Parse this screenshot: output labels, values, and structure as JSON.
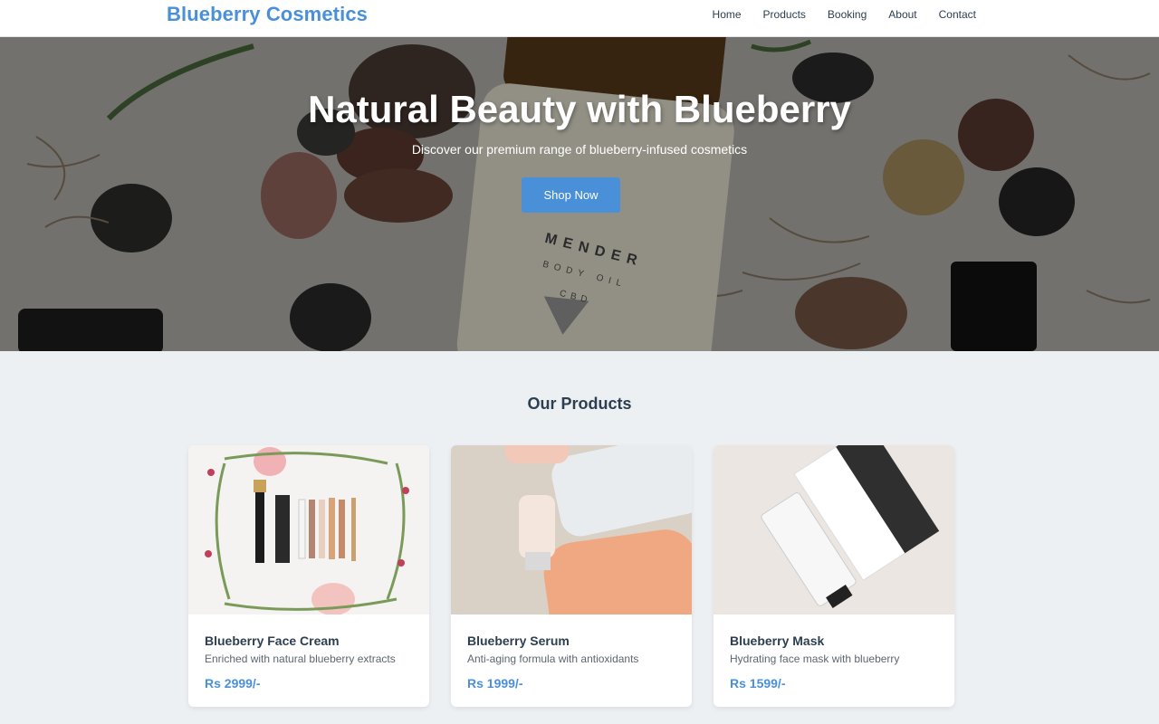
{
  "brand": "Blueberry Cosmetics",
  "nav": {
    "items": [
      {
        "label": "Home"
      },
      {
        "label": "Products"
      },
      {
        "label": "Booking"
      },
      {
        "label": "About"
      },
      {
        "label": "Contact"
      }
    ]
  },
  "hero": {
    "title": "Natural Beauty with Blueberry",
    "subtitle": "Discover our premium range of blueberry-infused cosmetics",
    "cta_label": "Shop Now",
    "bottle_label_lines": [
      "MENDER",
      "BODY OIL",
      "CBD"
    ]
  },
  "products": {
    "heading": "Our Products",
    "items": [
      {
        "name": "Blueberry Face Cream",
        "description": "Enriched with natural blueberry extracts",
        "price": "Rs 2999/-"
      },
      {
        "name": "Blueberry Serum",
        "description": "Anti-aging formula with antioxidants",
        "price": "Rs 1999/-"
      },
      {
        "name": "Blueberry Mask",
        "description": "Hydrating face mask with blueberry",
        "price": "Rs 1599/-"
      }
    ]
  },
  "colors": {
    "accent": "#4a90d9",
    "text_dark": "#2c3e50",
    "page_bg": "#edf0f3"
  }
}
